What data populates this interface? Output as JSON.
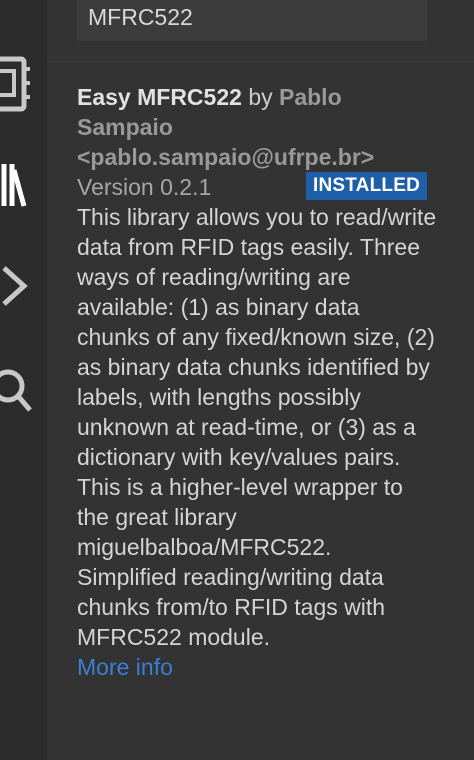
{
  "search": {
    "value": "MFRC522"
  },
  "extension": {
    "name": "Easy MFRC522",
    "by": "by",
    "author": "Pablo Sampaio <pablo.sampaio@ufrpe.br>",
    "version": "Version 0.2.1",
    "badge": "INSTALLED",
    "description": "This library allows you to read/write data from RFID tags easily. Three ways of reading/writing are available: (1) as binary data chunks of any fixed/known size, (2) as binary data chunks identified by labels, with lengths possibly unknown at read-time, or (3) as a dictionary with key/values pairs. This is a higher-level wrapper to the great library miguelbalboa/MFRC522. Simplified reading/writing data chunks from/to RFID tags with MFRC522 module.",
    "more_info": "More info"
  },
  "activity_bar": {
    "icons": [
      "board-icon",
      "library-icon",
      "serial-monitor-icon",
      "search-icon"
    ]
  },
  "colors": {
    "badge": "#1e5fa8",
    "link": "#3a7fd5",
    "background": "#333333"
  }
}
